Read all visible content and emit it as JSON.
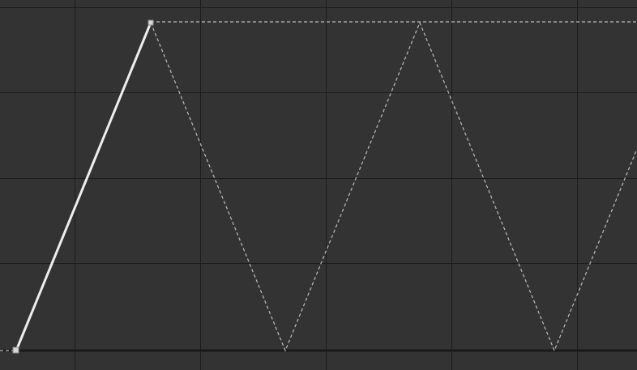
{
  "graph_editor": {
    "colors": {
      "background": "#333333",
      "grid": "#1c1c1c",
      "active_curve": "#eeeeee",
      "cycle_curve": "#bdbdbd",
      "keyframe": "#d8d8d8"
    },
    "curve": {
      "interpolation": "linear",
      "extrapolation": "cycle",
      "keyframes": [
        {
          "frame": 0,
          "value": 0
        },
        {
          "frame": 1,
          "value": 1
        }
      ]
    }
  }
}
